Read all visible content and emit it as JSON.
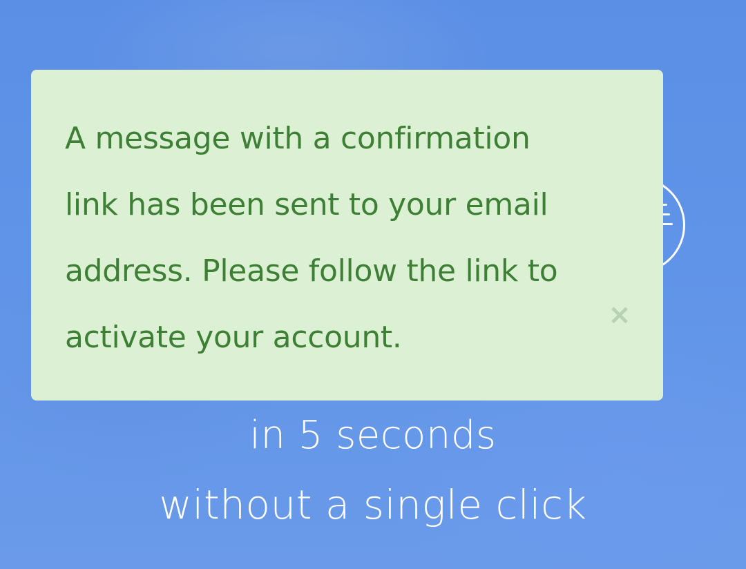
{
  "alert": {
    "message": "A message with a confirmation link has been sent to your email address. Please follow the link to activate your account.",
    "close_glyph": "×",
    "background_color": "#dcf0d3",
    "text_color": "#3d7f35"
  },
  "menu": {
    "icon": "menu-icon"
  },
  "hero": {
    "line1": "in 5 seconds",
    "line2": "without a single click"
  },
  "colors": {
    "background": "#5f93e7"
  }
}
